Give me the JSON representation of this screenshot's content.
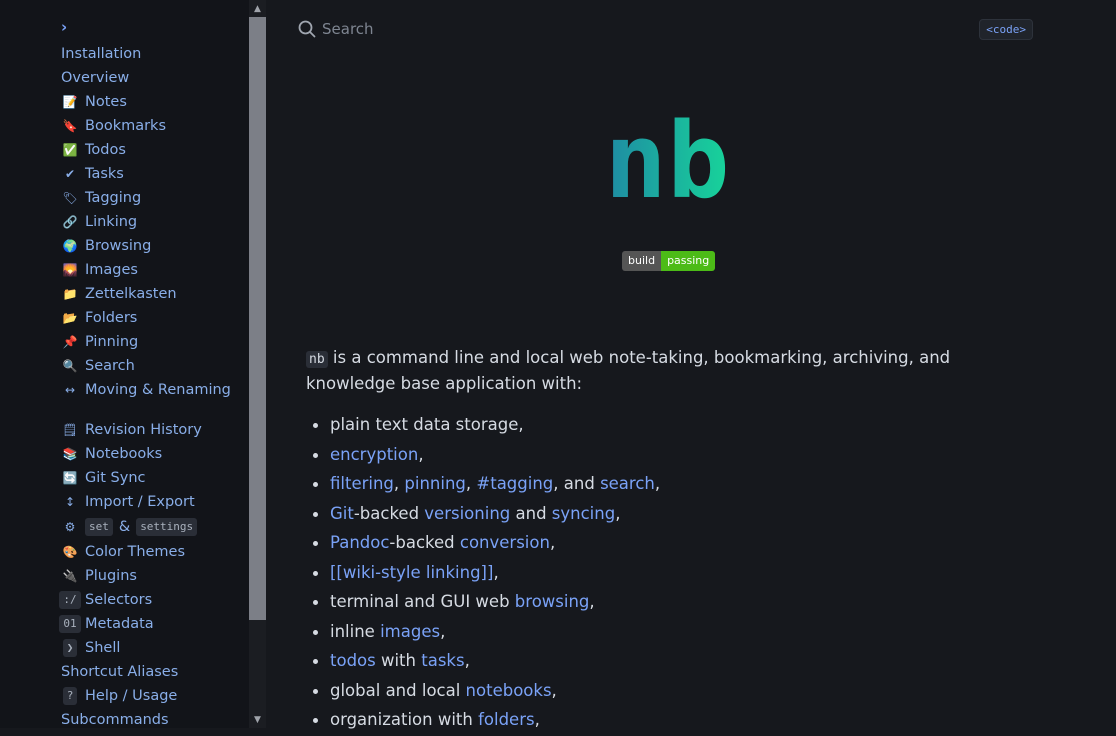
{
  "sidebar": {
    "chevron": "›",
    "items": [
      {
        "icon": "",
        "icon_name": "none",
        "label": "Installation"
      },
      {
        "icon": "",
        "icon_name": "none",
        "label": "Overview"
      },
      {
        "icon": "📝",
        "icon_name": "memo-icon",
        "label": "Notes"
      },
      {
        "icon": "🔖",
        "icon_name": "bookmark-icon",
        "label": "Bookmarks"
      },
      {
        "icon": "✅",
        "icon_name": "checkbox-icon",
        "label": "Todos"
      },
      {
        "icon": "✔",
        "icon_name": "check-icon",
        "label": "Tasks"
      },
      {
        "icon": "🏷",
        "icon_name": "tag-icon",
        "label": "Tagging"
      },
      {
        "icon": "🔗",
        "icon_name": "link-icon",
        "label": "Linking"
      },
      {
        "icon": "🌍",
        "icon_name": "globe-icon",
        "label": "Browsing"
      },
      {
        "icon": "🌄",
        "icon_name": "image-icon",
        "label": "Images"
      },
      {
        "icon": "📁",
        "icon_name": "folder-icon",
        "label": "Zettelkasten"
      },
      {
        "icon": "📂",
        "icon_name": "open-folder-icon",
        "label": "Folders"
      },
      {
        "icon": "📌",
        "icon_name": "pin-icon",
        "label": "Pinning"
      },
      {
        "icon": "🔍",
        "icon_name": "magnifier-icon",
        "label": "Search"
      },
      {
        "icon": "↔",
        "icon_name": "arrows-icon",
        "label": "Moving & Renaming"
      },
      {
        "icon": "🗒",
        "icon_name": "notepad-icon",
        "label": "Revision History"
      },
      {
        "icon": "📚",
        "icon_name": "books-icon",
        "label": "Notebooks"
      },
      {
        "icon": "🔄",
        "icon_name": "sync-icon",
        "label": "Git Sync"
      },
      {
        "icon": "↕",
        "icon_name": "import-export-icon",
        "label": "Import / Export"
      },
      {
        "icon": "⚙",
        "icon_name": "gear-icon",
        "label_code_a": "set",
        "amp": "&",
        "label_code_b": "settings"
      },
      {
        "icon": "🎨",
        "icon_name": "palette-icon",
        "label": "Color Themes"
      },
      {
        "icon": "🔌",
        "icon_name": "plug-icon",
        "label": "Plugins"
      },
      {
        "icon": ":/",
        "icon_name": "selector-chip-icon",
        "label": "Selectors"
      },
      {
        "icon": "01",
        "icon_name": "metadata-chip-icon",
        "label": "Metadata"
      },
      {
        "icon": "❯",
        "icon_name": "shell-chip-icon",
        "label": "Shell"
      },
      {
        "icon": "",
        "icon_name": "none",
        "label": "Shortcut Aliases"
      },
      {
        "icon": "?",
        "icon_name": "help-chip-icon",
        "label": "Help / Usage"
      },
      {
        "icon": "",
        "icon_name": "none",
        "label": "Subcommands"
      }
    ]
  },
  "main": {
    "search_placeholder": "Search",
    "code_link": "<code>",
    "logo_text": "nb",
    "badge": {
      "left": "build",
      "right": "passing"
    },
    "intro": {
      "code": "nb",
      "text": "is a command line and local web note-taking, bookmarking, archiving, and knowledge base application with:"
    },
    "features": [
      [
        {
          "t": "plain text data storage,"
        }
      ],
      [
        {
          "t": "encryption",
          "link": true
        },
        {
          "t": ","
        }
      ],
      [
        {
          "t": "filtering",
          "link": true
        },
        {
          "t": ", "
        },
        {
          "t": "pinning",
          "link": true
        },
        {
          "t": ", "
        },
        {
          "t": "#tagging",
          "link": true
        },
        {
          "t": ", and "
        },
        {
          "t": "search",
          "link": true
        },
        {
          "t": ","
        }
      ],
      [
        {
          "t": "Git",
          "link": true
        },
        {
          "t": "-backed "
        },
        {
          "t": "versioning",
          "link": true
        },
        {
          "t": " and "
        },
        {
          "t": "syncing",
          "link": true
        },
        {
          "t": ","
        }
      ],
      [
        {
          "t": "Pandoc",
          "link": true
        },
        {
          "t": "-backed "
        },
        {
          "t": "conversion",
          "link": true
        },
        {
          "t": ","
        }
      ],
      [
        {
          "t": "[[wiki-style linking]]",
          "link": true
        },
        {
          "t": ","
        }
      ],
      [
        {
          "t": "terminal and GUI web "
        },
        {
          "t": "browsing",
          "link": true
        },
        {
          "t": ","
        }
      ],
      [
        {
          "t": "inline "
        },
        {
          "t": "images",
          "link": true
        },
        {
          "t": ","
        }
      ],
      [
        {
          "t": "todos",
          "link": true
        },
        {
          "t": " with "
        },
        {
          "t": "tasks",
          "link": true
        },
        {
          "t": ","
        }
      ],
      [
        {
          "t": "global and local "
        },
        {
          "t": "notebooks",
          "link": true
        },
        {
          "t": ","
        }
      ],
      [
        {
          "t": "organization with "
        },
        {
          "t": "folders",
          "link": true
        },
        {
          "t": ","
        }
      ]
    ]
  },
  "colors": {
    "accent": "#7aa2f7",
    "logo_start": "#1f8aa3",
    "logo_end": "#17d49a",
    "badge_pass": "#4cbb17"
  }
}
